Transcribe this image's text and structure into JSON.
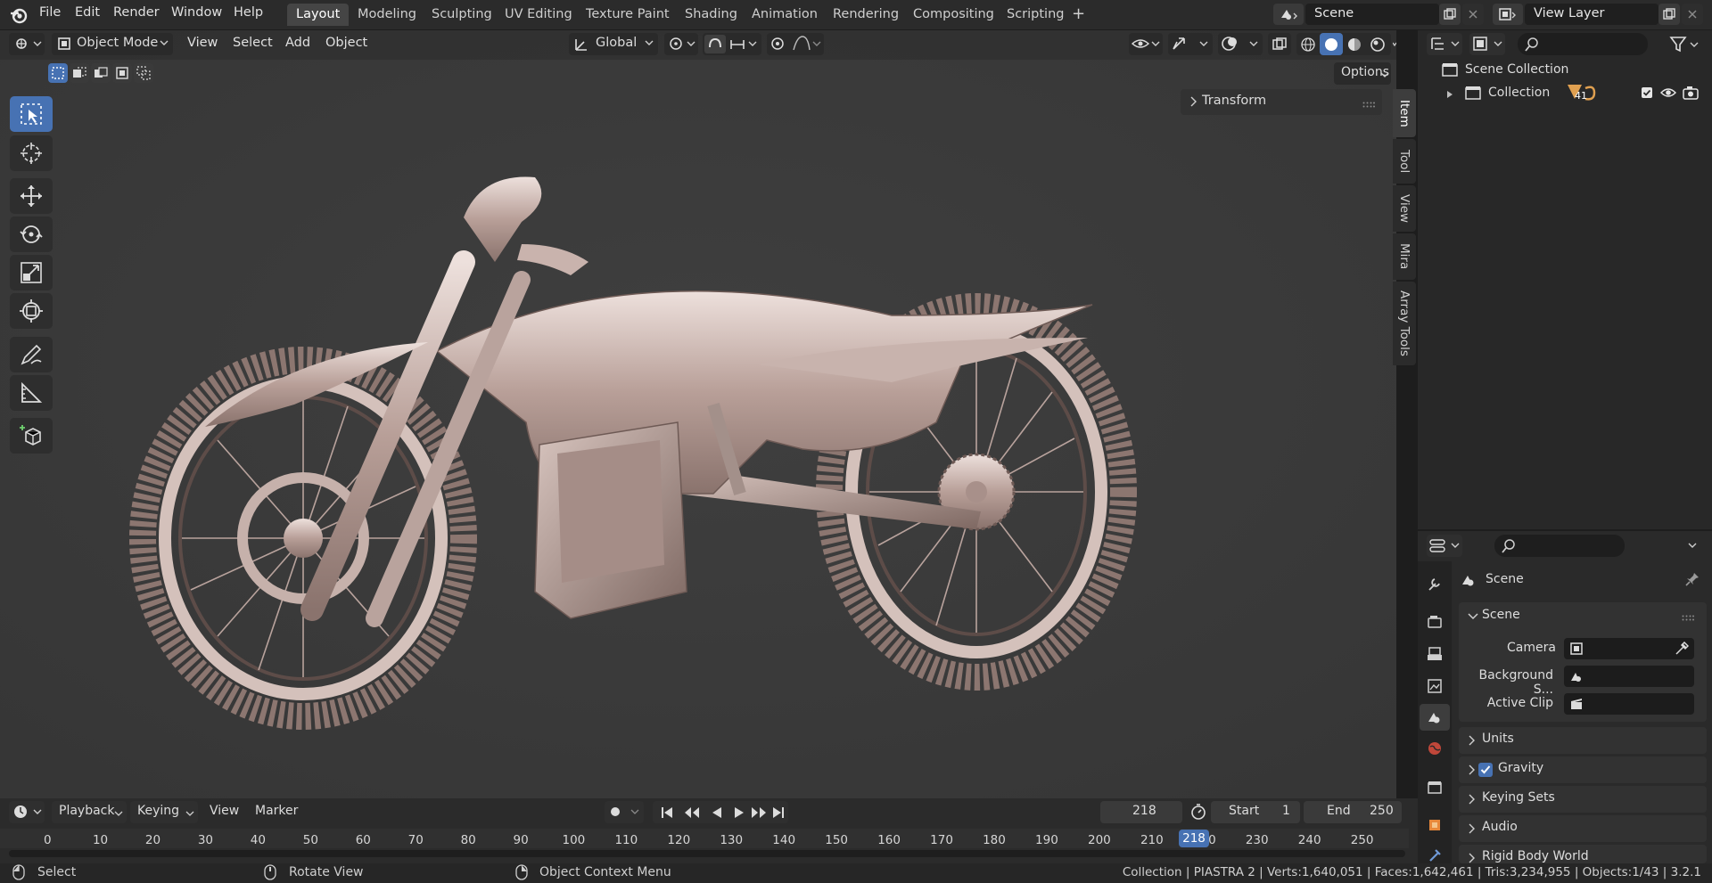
{
  "topbar": {
    "menus": [
      "File",
      "Edit",
      "Render",
      "Window",
      "Help"
    ],
    "workspaces": [
      "Layout",
      "Modeling",
      "Sculpting",
      "UV Editing",
      "Texture Paint",
      "Shading",
      "Animation",
      "Rendering",
      "Compositing",
      "Scripting"
    ],
    "active_workspace": "Layout",
    "add_tab": "+",
    "scene_name": "Scene",
    "view_layer": "View Layer"
  },
  "viewport": {
    "mode": "Object Mode",
    "menus": [
      "View",
      "Select",
      "Add",
      "Object"
    ],
    "transform_orientation": "Global",
    "options_label": "Options",
    "n_panel": {
      "transform_label": "Transform"
    },
    "side_tabs": [
      "Item",
      "Tool",
      "View",
      "Mira",
      "Array Tools"
    ],
    "active_side_tab": "Item"
  },
  "outliner": {
    "root": "Scene Collection",
    "collection": "Collection",
    "collection_count": "41"
  },
  "properties": {
    "context_title": "Scene",
    "panel_scene": "Scene",
    "rows": [
      {
        "label": "Camera"
      },
      {
        "label": "Background S..."
      },
      {
        "label": "Active Clip"
      }
    ],
    "panels": [
      "Units",
      "Gravity",
      "Keying Sets",
      "Audio",
      "Rigid Body World"
    ],
    "gravity_checked": true
  },
  "timeline": {
    "menus": [
      "Playback",
      "Keying",
      "View",
      "Marker"
    ],
    "current_frame": "218",
    "start_label": "Start",
    "start_value": "1",
    "end_label": "End",
    "end_value": "250",
    "ticks": [
      "0",
      "10",
      "20",
      "30",
      "40",
      "50",
      "60",
      "70",
      "80",
      "90",
      "100",
      "110",
      "120",
      "130",
      "140",
      "150",
      "160",
      "170",
      "180",
      "190",
      "200",
      "210",
      "220",
      "230",
      "240",
      "250"
    ],
    "playhead_label": "218"
  },
  "statusbar": {
    "select": "Select",
    "rotate": "Rotate View",
    "context_menu": "Object Context Menu",
    "stats": "Collection | PIASTRA 2 | Verts:1,640,051 | Faces:1,642,461 | Tris:3,234,955 | Objects:1/43 | 3.2.1"
  },
  "colors": {
    "accent": "#4772b3",
    "header_bg": "#2b2b2b",
    "viewport_bg": "#3b3b3b",
    "model": "#c9b3ad",
    "collection_icon": "#e0a050"
  }
}
